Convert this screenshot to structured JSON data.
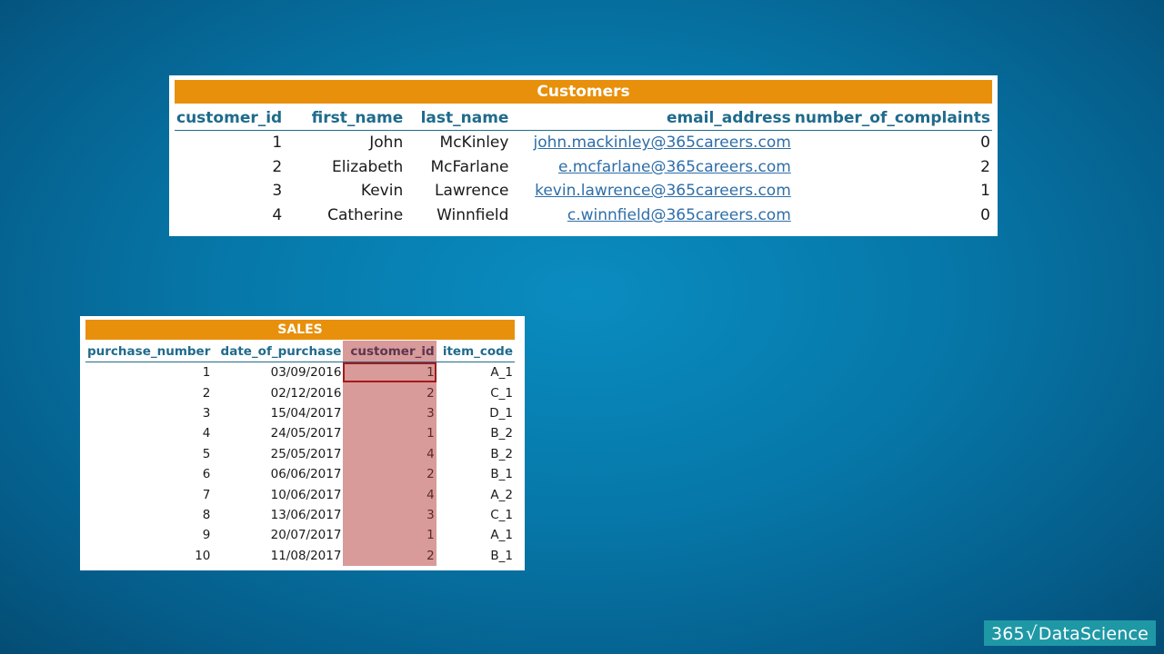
{
  "customers": {
    "title": "Customers",
    "columns": [
      "customer_id",
      "first_name",
      "last_name",
      "email_address",
      "number_of_complaints"
    ],
    "rows": [
      [
        "1",
        "John",
        "McKinley",
        "john.mackinley@365careers.com",
        "0"
      ],
      [
        "2",
        "Elizabeth",
        "McFarlane",
        "e.mcfarlane@365careers.com",
        "2"
      ],
      [
        "3",
        "Kevin",
        "Lawrence",
        "kevin.lawrence@365careers.com",
        "1"
      ],
      [
        "4",
        "Catherine",
        "Winnfield",
        "c.winnfield@365careers.com",
        "0"
      ]
    ]
  },
  "sales": {
    "title": "SALES",
    "columns": [
      "purchase_number",
      "date_of_purchase",
      "customer_id",
      "item_code"
    ],
    "highlighted_column": "customer_id",
    "highlight_color": "#d99a9a",
    "selected_cell": {
      "row": 1,
      "column": "customer_id"
    },
    "rows": [
      [
        "1",
        "03/09/2016",
        "1",
        "A_1"
      ],
      [
        "2",
        "02/12/2016",
        "2",
        "C_1"
      ],
      [
        "3",
        "15/04/2017",
        "3",
        "D_1"
      ],
      [
        "4",
        "24/05/2017",
        "1",
        "B_2"
      ],
      [
        "5",
        "25/05/2017",
        "4",
        "B_2"
      ],
      [
        "6",
        "06/06/2017",
        "2",
        "B_1"
      ],
      [
        "7",
        "10/06/2017",
        "4",
        "A_2"
      ],
      [
        "8",
        "13/06/2017",
        "3",
        "C_1"
      ],
      [
        "9",
        "20/07/2017",
        "1",
        "A_1"
      ],
      [
        "10",
        "11/08/2017",
        "2",
        "B_1"
      ]
    ]
  },
  "logo": {
    "prefix": "365",
    "icon": "check-icon",
    "suffix": "DataScience"
  },
  "colors": {
    "title_bar": "#e8900b",
    "header_text": "#1f6b8c",
    "link": "#2e6ea8",
    "selection_border": "#a31b1b",
    "logo_bg": "#1f98a6"
  }
}
